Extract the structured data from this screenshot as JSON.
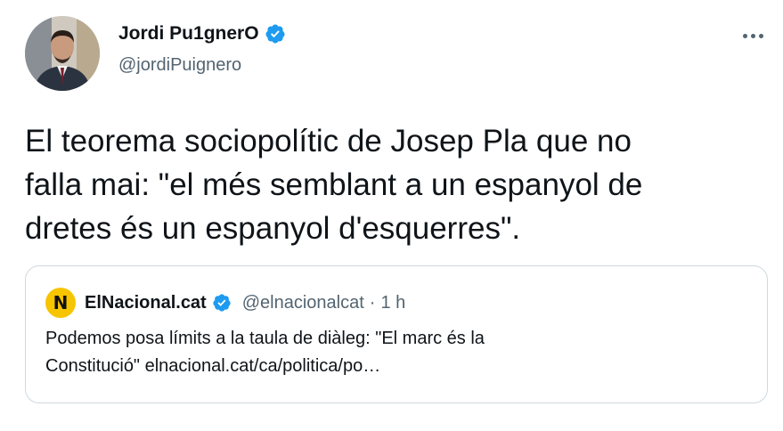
{
  "author": {
    "display_name": "Jordi Pu1gnerO",
    "handle": "@jordiPuignero",
    "verified": true
  },
  "tweet": {
    "text": "El teorema sociopolític de Josep Pla que no\nfalla mai: \"el més semblant a un espanyol de\ndretes és un espanyol d'esquerres\"."
  },
  "quoted_tweet": {
    "logo_letter": "N",
    "display_name": "ElNacional.cat",
    "handle": "@elnacionalcat",
    "separator": "·",
    "time": "1 h",
    "verified": true,
    "text": "Podemos posa límits a la taula de diàleg: \"El marc és la\nConstitució\" elnacional.cat/ca/politica/po…"
  },
  "colors": {
    "verified_blue": "#1d9bf0",
    "secondary_text": "#536471",
    "border": "#cfd9de",
    "logo_yellow": "#f7c400"
  },
  "icons": {
    "verified": "verified-badge-icon",
    "more": "more-options-icon"
  }
}
